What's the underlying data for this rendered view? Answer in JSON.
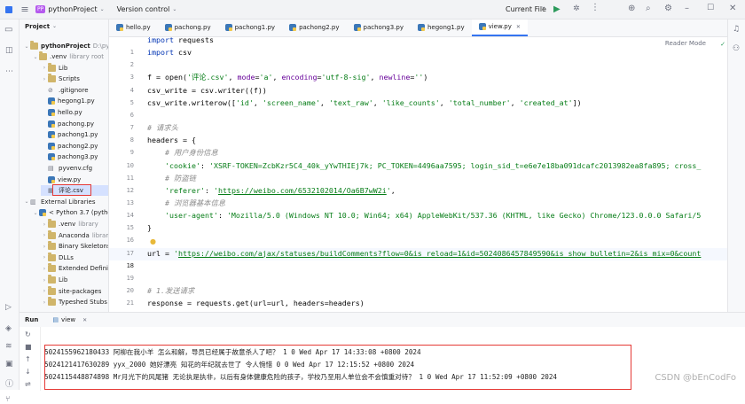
{
  "titlebar": {
    "app_badge": "PP",
    "project_name": "pythonProject",
    "vcs": "Version control",
    "run_config": "Current File"
  },
  "project_panel": {
    "title": "Project",
    "root": "pythonProject",
    "root_path": "D:\\pytho",
    "items": [
      {
        "label": "venv",
        "extra": "library root",
        "type": "folder",
        "indent": 1,
        "open": true,
        "prefix": "."
      },
      {
        "label": "Lib",
        "type": "folder",
        "indent": 2
      },
      {
        "label": "Scripts",
        "type": "folder",
        "indent": 2
      },
      {
        "label": ".gitignore",
        "type": "ignore",
        "indent": 2
      },
      {
        "label": "hegong1.py",
        "type": "py",
        "indent": 2
      },
      {
        "label": "hello.py",
        "type": "py",
        "indent": 2
      },
      {
        "label": "pachong.py",
        "type": "py",
        "indent": 2
      },
      {
        "label": "pachong1.py",
        "type": "py",
        "indent": 2
      },
      {
        "label": "pachong2.py",
        "type": "py",
        "indent": 2
      },
      {
        "label": "pachong3.py",
        "type": "py",
        "indent": 2
      },
      {
        "label": "pyvenv.cfg",
        "type": "cfg",
        "indent": 2
      },
      {
        "label": "view.py",
        "type": "py",
        "indent": 2
      },
      {
        "label": "评论.csv",
        "type": "csv",
        "indent": 2,
        "selected": true
      },
      {
        "label": "External Libraries",
        "type": "lib",
        "indent": 0,
        "open": true
      },
      {
        "label": "< Python 3.7 (pytho",
        "type": "py",
        "indent": 1,
        "open": true
      },
      {
        "label": ".venv",
        "extra": "library",
        "type": "folder",
        "indent": 2
      },
      {
        "label": "Anaconda",
        "extra": "library",
        "type": "folder",
        "indent": 2
      },
      {
        "label": "Binary Skeletons",
        "type": "folder",
        "indent": 2
      },
      {
        "label": "DLLs",
        "type": "folder",
        "indent": 2
      },
      {
        "label": "Extended Definitio",
        "type": "folder",
        "indent": 2
      },
      {
        "label": "Lib",
        "type": "folder",
        "indent": 2
      },
      {
        "label": "site-packages",
        "type": "folder",
        "indent": 2
      },
      {
        "label": "Typeshed Stubs",
        "type": "folder",
        "indent": 2
      }
    ]
  },
  "tabs": [
    "hello.py",
    "pachong.py",
    "pachong1.py",
    "pachong2.py",
    "pachong3.py",
    "hegong1.py",
    "view.py"
  ],
  "active_tab": "view.py",
  "reader_mode": "Reader Mode",
  "line_numbers": [
    "1",
    "2",
    "3",
    "4",
    "5",
    "6",
    "7",
    "8",
    "9",
    "10",
    "11",
    "12",
    "13",
    "14",
    "15",
    "16",
    "17",
    "18",
    "19",
    "20",
    "21"
  ],
  "code_lines": [
    {
      "html": "<span class='kw'>import</span> requests"
    },
    {
      "html": "<span class='kw'>import</span> csv"
    },
    {
      "html": ""
    },
    {
      "html": "f = open(<span class='str'>'评论.csv'</span>, <span class='kwa'>mode</span>=<span class='str'>'a'</span>, <span class='kwa'>encoding</span>=<span class='str'>'utf-8-sig'</span>, <span class='kwa'>newline</span>=<span class='str'>''</span>)"
    },
    {
      "html": "csv_write = csv.writer((f))"
    },
    {
      "html": "csv_write.writerow([<span class='str'>'id'</span>, <span class='str'>'screen_name'</span>, <span class='str'>'text_raw'</span>, <span class='str'>'like_counts'</span>, <span class='str'>'total_number'</span>, <span class='str'>'created_at'</span>])"
    },
    {
      "html": ""
    },
    {
      "html": "<span class='cm'># 请求头</span>"
    },
    {
      "html": "headers = {"
    },
    {
      "html": "    <span class='cm'># 用户身份信息</span>"
    },
    {
      "html": "    <span class='str'>'cookie'</span>: <span class='str'>'XSRF-TOKEN=ZcbKzr5C4_40k_yYwTHIEj7k; PC_TOKEN=4496aa7595; login_sid_t=e6e7e18ba091dcafc2013982ea8fa895; cross_</span>"
    },
    {
      "html": "    <span class='cm'># 防盗链</span>"
    },
    {
      "html": "    <span class='str'>'referer'</span>: <span class='str'>'</span><span class='url'>https://weibo.com/6532102014/Oa6B7wW2i</span><span class='str'>'</span>,"
    },
    {
      "html": "    <span class='cm'># 浏览器基本信息</span>"
    },
    {
      "html": "    <span class='str'>'user-agent'</span>: <span class='str'>'Mozilla/5.0 (Windows NT 10.0; Win64; x64) AppleWebKit/537.36 (KHTML, like Gecko) Chrome/123.0.0.0 Safari/5</span>"
    },
    {
      "html": "}"
    },
    {
      "html": ""
    },
    {
      "html": "url = <span class='str'>'</span><span class='url'>https://weibo.com/ajax/statuses/buildComments?flow=0&amp;is_reload=1&amp;id=5024086457849590&amp;is_show_bulletin=2&amp;is_mix=0&amp;count</span>"
    },
    {
      "html": ""
    },
    {
      "html": ""
    },
    {
      "html": "<span class='cm'># 1.发送请求</span>"
    },
    {
      "html": "response = requests.get(url=url, headers=headers)"
    }
  ],
  "run_panel": {
    "title": "Run",
    "config": "view",
    "output": [
      "5024155962180433 阿柳在我小羊 怎么和解，导员已经属于故意杀人了吧？ 1 0 Wed Apr 17 14:33:08 +0800 2024",
      "5024121417630289 yyx_2000 她好漂亮 知花的年纪就去世了 令人惋惜 0 0 Wed Apr 17 12:15:52 +0800 2024",
      "5024115448874898 Mr月光下的风尾猪 无论执是执非，以后有身体健康危险的孩子，学校乃至用人单位会不会慎重对待？ 1 0 Wed Apr 17 11:52:09 +0800 2024"
    ]
  },
  "watermark": "CSDN @bEnCodFo"
}
